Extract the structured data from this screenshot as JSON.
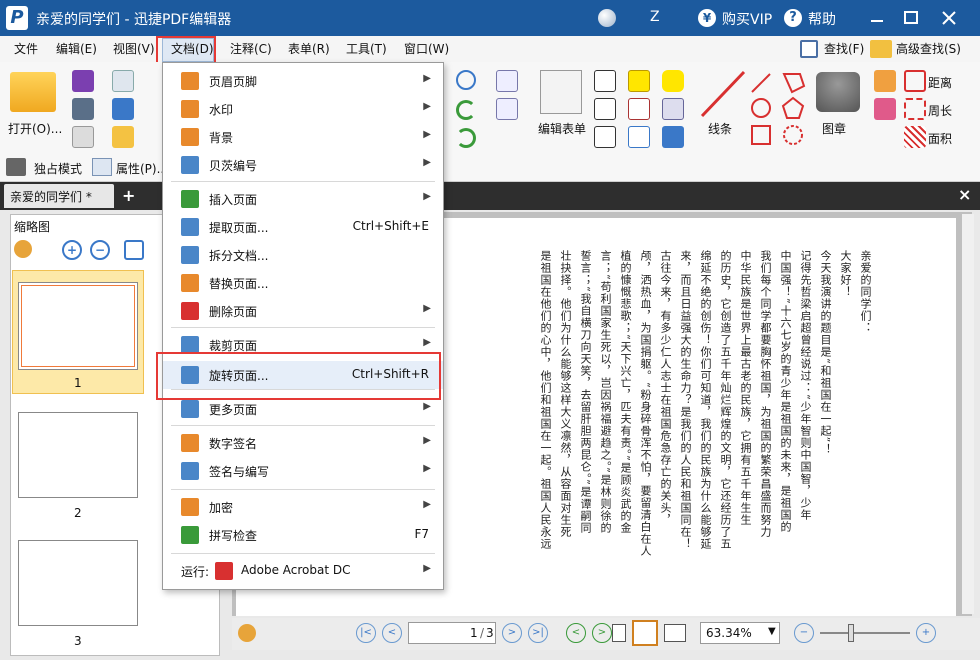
{
  "window": {
    "title": "亲爱的同学们 - 迅捷PDF编辑器",
    "user": "Z",
    "vip": "购买VIP",
    "help": "帮助",
    "vip_icon": "¥",
    "help_icon": "?"
  },
  "menubar": [
    {
      "label": "文件"
    },
    {
      "label": "编辑(E)"
    },
    {
      "label": "视图(V)"
    },
    {
      "label": "文档(D)"
    },
    {
      "label": "注释(C)"
    },
    {
      "label": "表单(R)"
    },
    {
      "label": "工具(T)"
    },
    {
      "label": "窗口(W)"
    }
  ],
  "search": {
    "find": "查找(F)",
    "advanced": "高级查找(S)"
  },
  "ribbon": {
    "open": "打开(O)...",
    "exclusive": "独占模式",
    "properties": "属性(P)...",
    "edit_form": "编辑表单",
    "line": "线条",
    "stamp": "图章",
    "distance": "距离",
    "perimeter": "周长",
    "area": "面积"
  },
  "tab": {
    "name": "亲爱的同学们 *",
    "plus": "+",
    "close": "×"
  },
  "panel": {
    "title": "缩略图",
    "close": "×",
    "pages": [
      "1",
      "2",
      "3"
    ]
  },
  "document_menu": {
    "items": [
      {
        "label": "页眉页脚",
        "submenu": true,
        "color": "#e8892c"
      },
      {
        "label": "水印",
        "submenu": true,
        "color": "#e8892c"
      },
      {
        "label": "背景",
        "submenu": true,
        "color": "#e8892c"
      },
      {
        "label": "贝茨编号",
        "submenu": true,
        "color": "#4a86c8"
      },
      {
        "label": "插入页面",
        "submenu": true,
        "color": "#3a9a3a"
      },
      {
        "label": "提取页面...",
        "shortcut": "Ctrl+Shift+E",
        "color": "#4a86c8"
      },
      {
        "label": "拆分文档...",
        "color": "#4a86c8"
      },
      {
        "label": "替换页面...",
        "color": "#e8892c"
      },
      {
        "label": "删除页面",
        "submenu": true,
        "color": "#d83030"
      },
      {
        "label": "裁剪页面",
        "submenu": true,
        "color": "#4a86c8"
      },
      {
        "label": "旋转页面...",
        "shortcut": "Ctrl+Shift+R",
        "color": "#4a86c8"
      },
      {
        "label": "更多页面",
        "submenu": true,
        "color": "#4a86c8"
      },
      {
        "label": "数字签名",
        "submenu": true,
        "color": "#e8892c"
      },
      {
        "label": "签名与编写",
        "submenu": true,
        "color": "#4a86c8"
      },
      {
        "label": "加密",
        "submenu": true,
        "color": "#e8892c"
      },
      {
        "label": "拼写检查",
        "shortcut": "F7",
        "color": "#3a9a3a"
      },
      {
        "label": "Adobe Acrobat DC",
        "prefix": "运行:",
        "submenu": true,
        "color": "#d83030"
      }
    ]
  },
  "page_text": [
    "亲爱的同学们：",
    "大家好！",
    "今天我演讲的题目是“和祖国在一起”！",
    "记得先哲梁启超曾经说过：“少年智则中国智，少年",
    "中国强！”十六七岁的青少年是祖国的未来，是祖国的",
    "我们每个同学都要胸怀祖国，为祖国的繁荣昌盛而努力",
    "中华民族是世界上最古老的民族，它拥有五千年生生",
    "的历史，它创造了五千年灿烂辉煌的文明，它还经历了五",
    "绵延不绝的创伤！你们可知道，我们的民族为什么能够延",
    "来，而且日益强大的生命力？是我们的人民和祖国同在！",
    "古往今来，有多少仁人志士在祖国危急存亡的关头，",
    "颅，洒热血，为国捐躯。“粉身碎骨浑不怕，要留清白在人",
    "植的慷慨悲歌；“天下兴亡，匹夫有责。”是顾炎武的金",
    "言；“苟利国家生死以，岂因祸福避趋之。”是林则徐的",
    "誓言；“我自横刀向天笑，去留肝胆两昆仑。”是谭嗣同",
    "壮抉择。他们为什么能够这样大义凛然，从容面对生死",
    "是祖国在他们的心中，他们和祖国在一起。祖国人民永远"
  ],
  "statusbar": {
    "page_current": "1",
    "page_total": "3",
    "zoom": "63.34%"
  }
}
